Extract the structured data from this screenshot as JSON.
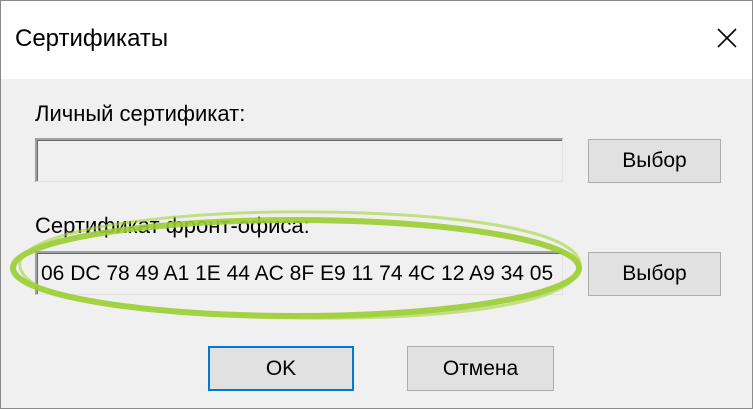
{
  "window": {
    "title": "Сертификаты",
    "close_glyph": "✕"
  },
  "personal": {
    "label": "Личный сертификат:",
    "value": "",
    "select_button": "Выбор"
  },
  "frontoffice": {
    "label": "Сертификат фронт-офиса:",
    "value": "06 DC 78 49 A1 1E 44 AC 8F E9 11 74 4C 12 A9 34 05",
    "select_button": "Выбор"
  },
  "footer": {
    "ok_button": "OK",
    "cancel_button": "Отмена"
  },
  "colors": {
    "dialog_bg": "#f0f0f0",
    "highlight_ellipse": "#9acd32",
    "default_button_border": "#0078d7"
  }
}
